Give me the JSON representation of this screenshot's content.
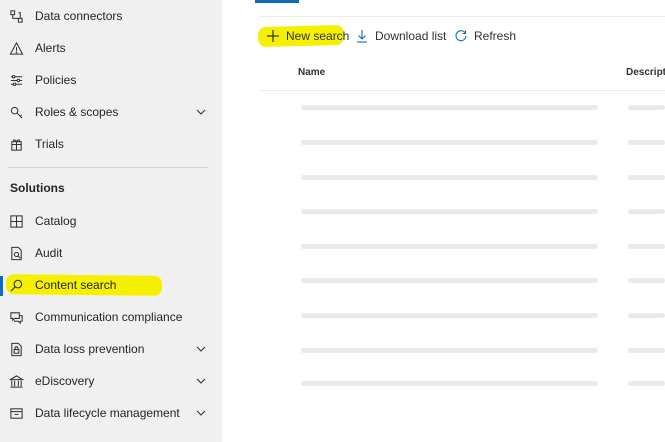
{
  "sidebar": {
    "items_top": [
      {
        "label": "Data connectors",
        "icon": "data-connectors-icon",
        "chevron": false
      },
      {
        "label": "Alerts",
        "icon": "alert-icon",
        "chevron": false
      },
      {
        "label": "Policies",
        "icon": "policies-icon",
        "chevron": false
      },
      {
        "label": "Roles & scopes",
        "icon": "roles-icon",
        "chevron": true
      },
      {
        "label": "Trials",
        "icon": "trials-icon",
        "chevron": false
      }
    ],
    "section_heading": "Solutions",
    "items_solutions": [
      {
        "label": "Catalog",
        "icon": "catalog-icon",
        "chevron": false
      },
      {
        "label": "Audit",
        "icon": "audit-icon",
        "chevron": false
      },
      {
        "label": "Content search",
        "icon": "search-icon",
        "chevron": false,
        "selected": true
      },
      {
        "label": "Communication compliance",
        "icon": "communication-icon",
        "chevron": false
      },
      {
        "label": "Data loss prevention",
        "icon": "dlp-icon",
        "chevron": true
      },
      {
        "label": "eDiscovery",
        "icon": "ediscovery-icon",
        "chevron": true
      },
      {
        "label": "Data lifecycle management",
        "icon": "lifecycle-icon",
        "chevron": true
      }
    ]
  },
  "toolbar": {
    "new_search": "New search",
    "download_list": "Download list",
    "refresh": "Refresh"
  },
  "table": {
    "columns": [
      "Name",
      "Descripti"
    ]
  },
  "colors": {
    "accent": "#0f6cbd",
    "highlight": "#f4f000",
    "sidebar_bg": "#f0f0f0"
  }
}
